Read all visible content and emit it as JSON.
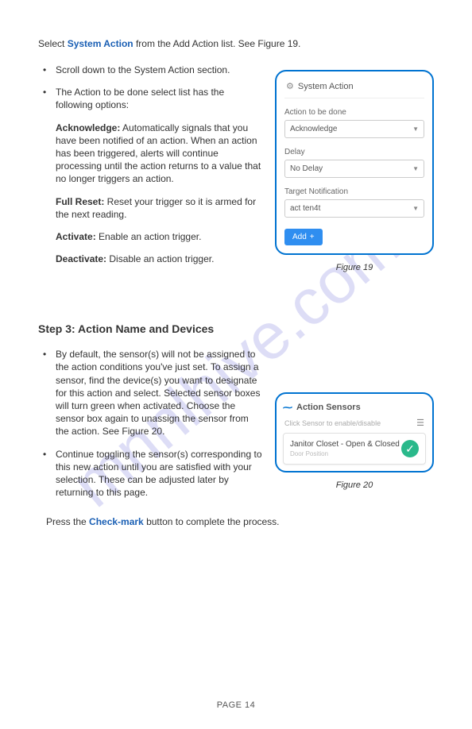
{
  "watermark": "mnnlhive.com",
  "intro": {
    "pre": "Select ",
    "link": "System Action",
    "post": " from the Add Action list. See Figure 19."
  },
  "section1": {
    "bullet1": "Scroll down to the System Action section.",
    "bullet2": "The Action to be done select list has the following options:",
    "ack_term": "Acknowledge:",
    "ack_text": " Automatically signals that you have been notified of an action. When an action has been triggered, alerts will continue processing until the action returns to a value that no longer triggers an action.",
    "reset_term": "Full Reset:",
    "reset_text": " Reset your trigger so it is armed for the next reading.",
    "activate_term": "Activate:",
    "activate_text": " Enable an action trigger.",
    "deactivate_term": "Deactivate:",
    "deactivate_text": " Disable an action trigger."
  },
  "panel19": {
    "title": "System Action",
    "label1": "Action to be done",
    "value1": "Acknowledge",
    "label2": "Delay",
    "value2": "No Delay",
    "label3": "Target Notification",
    "value3": "act ten4t",
    "add": "Add",
    "caption": "Figure 19"
  },
  "step3": {
    "heading": "Step 3: Action Name and Devices",
    "bullet1": "By default, the sensor(s) will not be assigned to the action conditions you've just set. To assign a sensor, find the device(s) you want to designate for this action and select. Selected sensor boxes will turn green when activated. Choose the sensor box again to unassign the sensor from the action. See Figure 20.",
    "bullet2": "Continue toggling the sensor(s) corresponding to this new action until you are satisfied with your selection. These can be adjusted later by returning to this page."
  },
  "panel20": {
    "title": "Action Sensors",
    "sub": "Click Sensor to enable/disable",
    "sensor_title": "Janitor Closet - Open & Closed",
    "sensor_sub": "Door Position",
    "caption": "Figure 20"
  },
  "press": {
    "pre": "Press the ",
    "link": "Check-mark",
    "post": " button to complete the process."
  },
  "page_num": "PAGE  14"
}
